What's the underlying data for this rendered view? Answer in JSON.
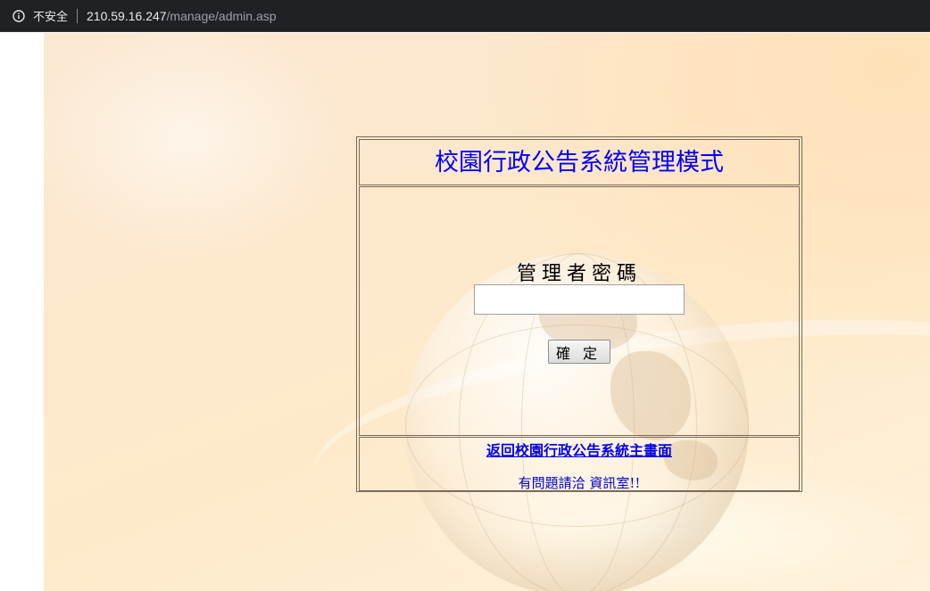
{
  "browser": {
    "security_label": "不安全",
    "url_host": "210.59.16.247",
    "url_path": "/manage/admin.asp",
    "icon": "info-icon"
  },
  "page": {
    "title": "校園行政公告系統管理模式",
    "password_label": "管理者密碼",
    "password_value": "",
    "password_placeholder": "",
    "confirm_label": "確定",
    "back_link": "返回校園行政公告系統主畫面",
    "contact": "有問題請洽 資訊室!!"
  },
  "colors": {
    "title": "#0000ff",
    "link": "#0000ee",
    "address_bar_bg": "#202124",
    "page_bg": "#fde8cc"
  }
}
